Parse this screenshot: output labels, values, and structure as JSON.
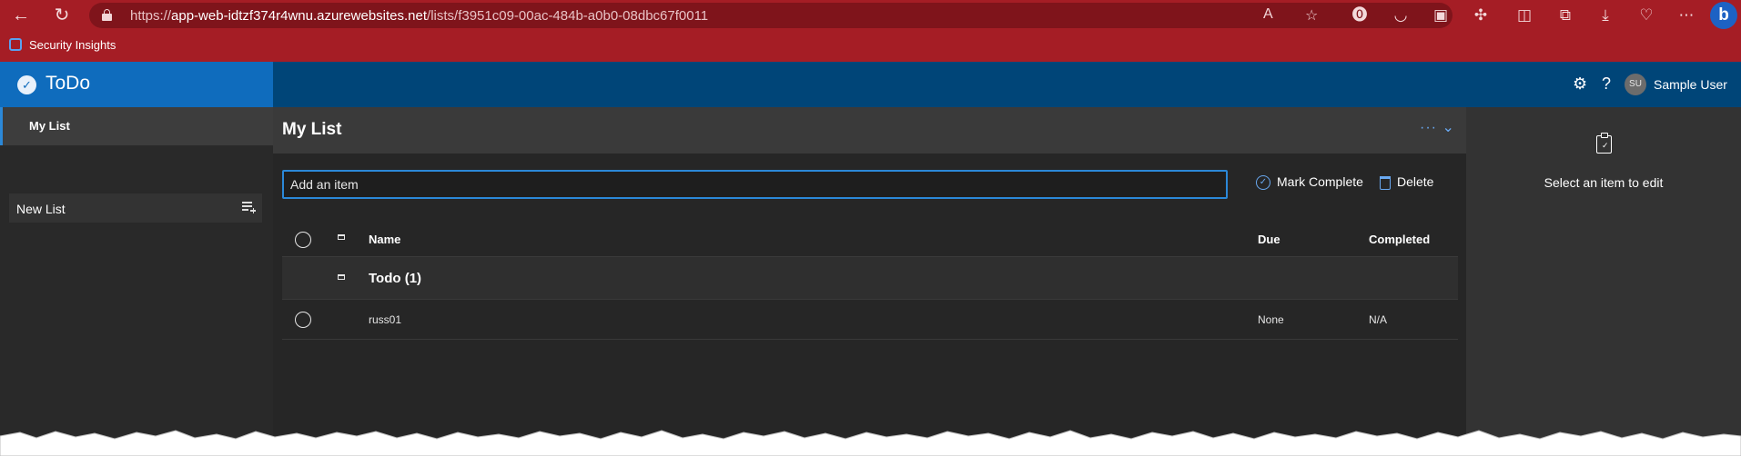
{
  "browser": {
    "url_prefix": "https://",
    "url_host": "app-web-idtzf374r4wnu.azurewebsites.net",
    "url_path": "/lists/f3951c09-00ac-484b-a0b0-08dbc67f0011",
    "favorite": "Security Insights"
  },
  "app": {
    "title": "ToDo",
    "user_initials": "SU",
    "user_name": "Sample User"
  },
  "sidebar": {
    "items": [
      {
        "label": "My List",
        "active": true
      }
    ],
    "new_list_label": "New List"
  },
  "main": {
    "title": "My List",
    "more_label": "···",
    "add_placeholder": "Add an item",
    "mark_complete_label": "Mark Complete",
    "delete_label": "Delete",
    "columns": {
      "name": "Name",
      "due": "Due",
      "completed": "Completed"
    },
    "group": {
      "label": "Todo (1)"
    },
    "rows": [
      {
        "name": "russ01",
        "due": "None",
        "completed": "N/A"
      }
    ]
  },
  "detail": {
    "hint": "Select an item to edit"
  },
  "colors": {
    "browser_frame": "#a51d25",
    "brand": "#0f6cbd",
    "header": "#004578",
    "accent": "#2b88d8"
  }
}
